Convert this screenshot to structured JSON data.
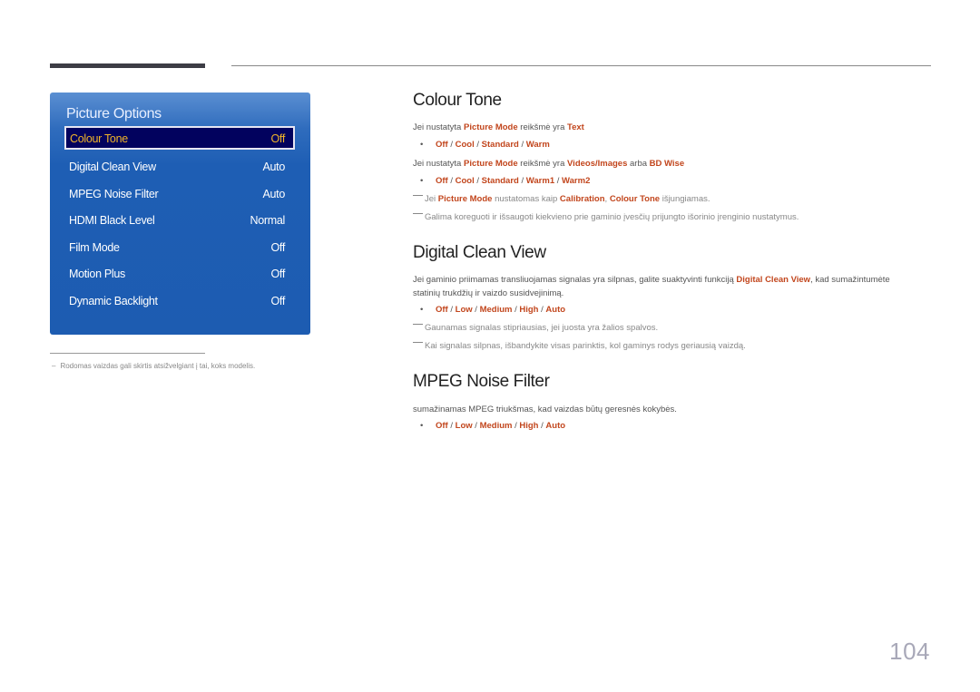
{
  "panel": {
    "title": "Picture Options",
    "items": [
      {
        "label": "Colour Tone",
        "value": "Off",
        "selected": true
      },
      {
        "label": "Digital Clean View",
        "value": "Auto"
      },
      {
        "label": "MPEG Noise Filter",
        "value": "Auto"
      },
      {
        "label": "HDMI Black Level",
        "value": "Normal"
      },
      {
        "label": "Film Mode",
        "value": "Off"
      },
      {
        "label": "Motion Plus",
        "value": "Off"
      },
      {
        "label": "Dynamic Backlight",
        "value": "Off"
      }
    ]
  },
  "footnote": {
    "dash": "–",
    "text": "Rodomas vaizdas gali skirtis atsižvelgiant į tai, koks modelis."
  },
  "colour_tone": {
    "title": "Colour Tone",
    "line1": {
      "pre": "Jei nustatyta ",
      "mode": "Picture Mode",
      "mid": " reikšmė yra ",
      "val": "Text"
    },
    "options1": [
      "Off",
      "Cool",
      "Standard",
      "Warm"
    ],
    "line2": {
      "pre": "Jei nustatyta ",
      "mode": "Picture Mode",
      "mid": " reikšmė yra ",
      "val1": "Videos/Images",
      "and": " arba ",
      "val2": "BD Wise"
    },
    "options2": [
      "Off",
      "Cool",
      "Standard",
      "Warm1",
      "Warm2"
    ],
    "note1": {
      "pre": "Jei ",
      "mode": "Picture Mode",
      "mid": " nustatomas kaip ",
      "calib": "Calibration",
      "comma": ", ",
      "tone": "Colour Tone",
      "post": " išjungiamas."
    },
    "note2": "Galima koreguoti ir išsaugoti kiekvieno prie gaminio įvesčių prijungto išorinio įrenginio nustatymus."
  },
  "digital_clean_view": {
    "title": "Digital Clean View",
    "desc_pre": "Jei gaminio priimamas transliuojamas signalas yra silpnas, galite suaktyvinti funkciją ",
    "desc_hl": "Digital Clean View",
    "desc_post": ", kad sumažintumėte",
    "desc_line2": "statinių trukdžių ir vaizdo susidvejinimą.",
    "options": [
      "Off",
      "Low",
      "Medium",
      "High",
      "Auto"
    ],
    "note1": "Gaunamas signalas stipriausias, jei juosta yra žalios spalvos.",
    "note2": "Kai signalas silpnas, išbandykite visas parinktis, kol gaminys rodys geriausią vaizdą."
  },
  "mpeg_noise_filter": {
    "title": "MPEG Noise Filter",
    "desc": "sumažinamas MPEG triukšmas, kad vaizdas būtų geresnės kokybės.",
    "options": [
      "Off",
      "Low",
      "Medium",
      "High",
      "Auto"
    ]
  },
  "separator": " / ",
  "bullet_char": "•",
  "page_number": "104"
}
